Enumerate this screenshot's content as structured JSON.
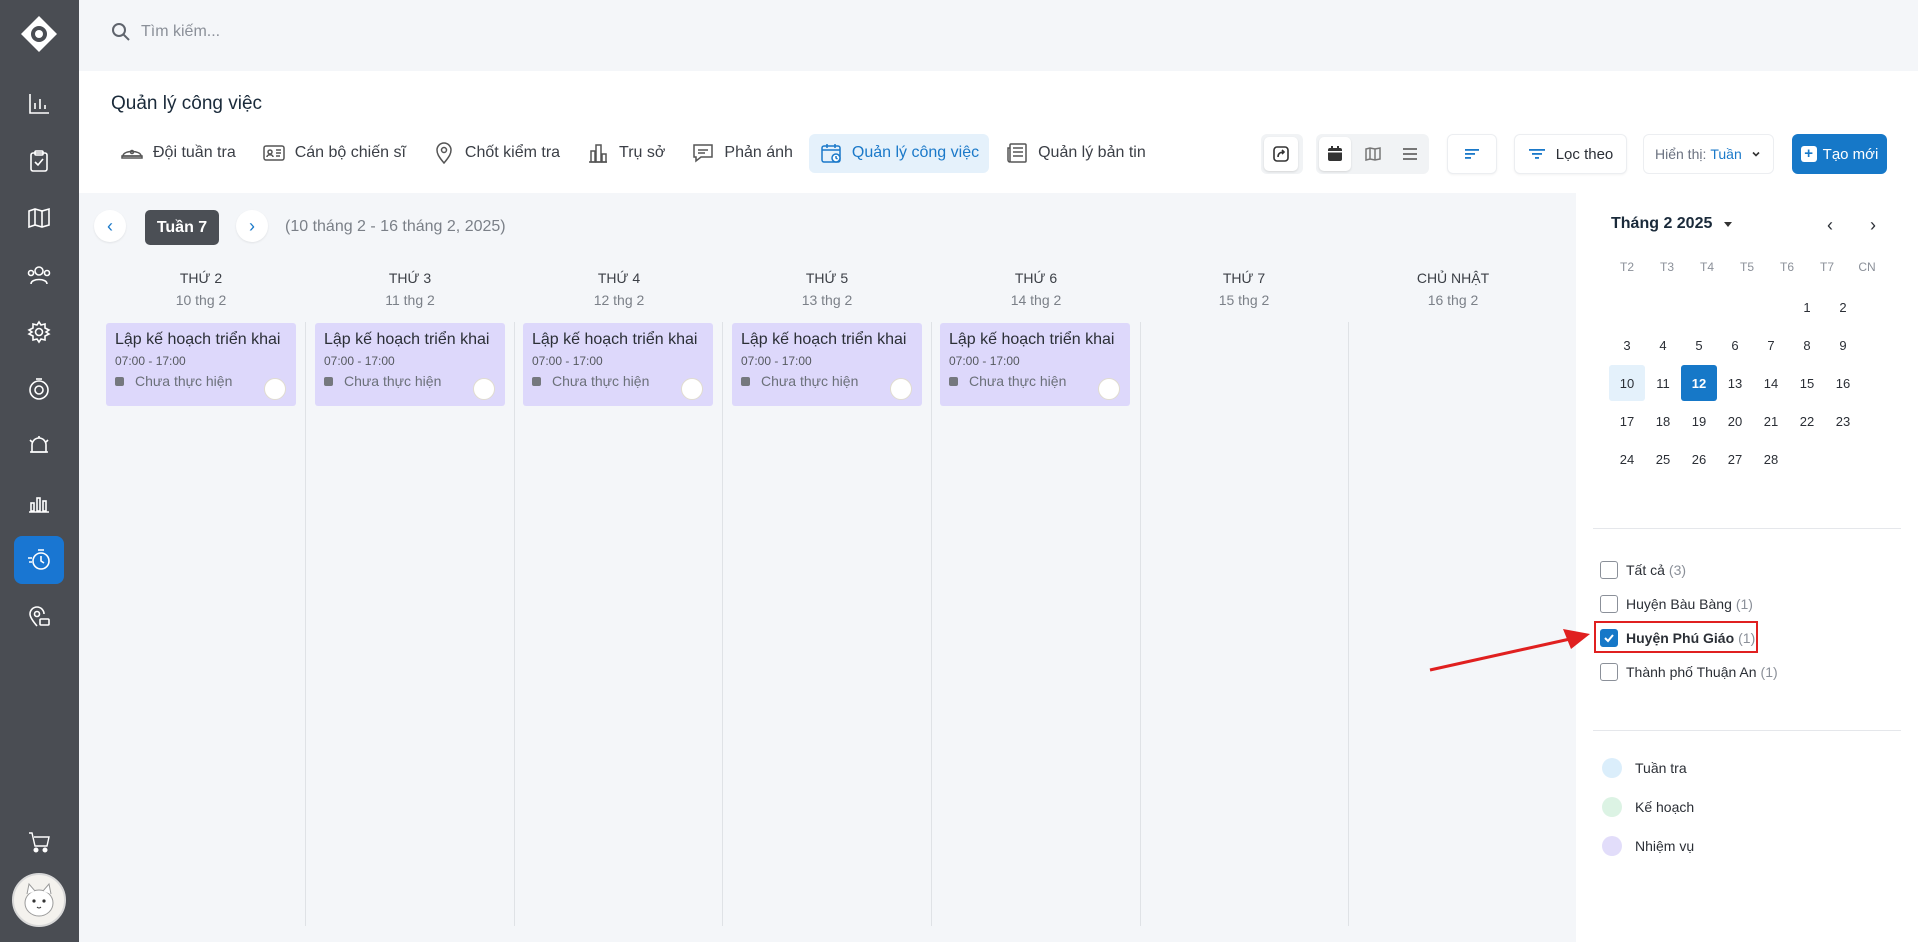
{
  "search": {
    "placeholder": "Tìm kiếm..."
  },
  "page": {
    "title": "Quản lý công việc"
  },
  "tabs": [
    {
      "label": "Đội tuần tra",
      "icon": "patrol-cap-icon"
    },
    {
      "label": "Cán bộ chiến sĩ",
      "icon": "id-card-icon"
    },
    {
      "label": "Chốt kiểm tra",
      "icon": "location-pin-icon"
    },
    {
      "label": "Trụ sở",
      "icon": "building-icon"
    },
    {
      "label": "Phản ánh",
      "icon": "chat-bubble-icon"
    },
    {
      "label": "Quản lý công việc",
      "icon": "calendar-icon",
      "active": true
    },
    {
      "label": "Quản lý bản tin",
      "icon": "newspaper-icon"
    }
  ],
  "toolbar": {
    "filter_label": "Lọc theo",
    "display_label": "Hiển thị:",
    "display_value": "Tuần",
    "create_label": "Tạo mới"
  },
  "week": {
    "badge": "Tuần 7",
    "range": "(10 tháng 2 - 16 tháng 2, 2025)"
  },
  "days": [
    {
      "name": "THỨ 2",
      "date": "10 thg 2"
    },
    {
      "name": "THỨ 3",
      "date": "11 thg 2"
    },
    {
      "name": "THỨ 4",
      "date": "12 thg 2"
    },
    {
      "name": "THỨ 5",
      "date": "13 thg 2"
    },
    {
      "name": "THỨ 6",
      "date": "14 thg 2"
    },
    {
      "name": "THỨ 7",
      "date": "15 thg 2"
    },
    {
      "name": "CHỦ NHẬT",
      "date": "16 thg 2"
    }
  ],
  "events": [
    {
      "title": "Lập kế hoạch triển khai",
      "time": "07:00 - 17:00",
      "status": "Chưa thực hiện"
    },
    {
      "title": "Lập kế hoạch triển khai",
      "time": "07:00 - 17:00",
      "status": "Chưa thực hiện"
    },
    {
      "title": "Lập kế hoạch triển khai",
      "time": "07:00 - 17:00",
      "status": "Chưa thực hiện"
    },
    {
      "title": "Lập kế hoạch triển khai",
      "time": "07:00 - 17:00",
      "status": "Chưa thực hiện"
    },
    {
      "title": "Lập kế hoạch triển khai",
      "time": "07:00 - 17:00",
      "status": "Chưa thực hiện"
    }
  ],
  "mini_calendar": {
    "title": "Tháng 2 2025",
    "weekdays": [
      "T2",
      "T3",
      "T4",
      "T5",
      "T6",
      "T7",
      "CN"
    ],
    "weeks": [
      [
        "",
        "",
        "",
        "",
        "",
        "1",
        "2"
      ],
      [
        "3",
        "4",
        "5",
        "6",
        "7",
        "8",
        "9"
      ],
      [
        "10",
        "11",
        "12",
        "13",
        "14",
        "15",
        "16"
      ],
      [
        "17",
        "18",
        "19",
        "20",
        "21",
        "22",
        "23"
      ],
      [
        "24",
        "25",
        "26",
        "27",
        "28",
        "",
        ""
      ]
    ],
    "selected_day": "12",
    "highlight_day": "10"
  },
  "filters": [
    {
      "label": "Tất cả",
      "count": "(3)",
      "checked": false
    },
    {
      "label": "Huyện Bàu Bàng",
      "count": "(1)",
      "checked": false
    },
    {
      "label": "Huyện Phú Giáo",
      "count": "(1)",
      "checked": true
    },
    {
      "label": "Thành phố Thuận An",
      "count": "(1)",
      "checked": false
    }
  ],
  "legend": [
    {
      "label": "Tuần tra",
      "color": "#dbeefb"
    },
    {
      "label": "Kế hoạch",
      "color": "#dcf3e4"
    },
    {
      "label": "Nhiệm vụ",
      "color": "#e2ddfa"
    }
  ],
  "colors": {
    "accent": "#1678c8",
    "rail": "#4a4d53",
    "event_bg": "#ddd8fb",
    "annotation": "#e02020"
  }
}
